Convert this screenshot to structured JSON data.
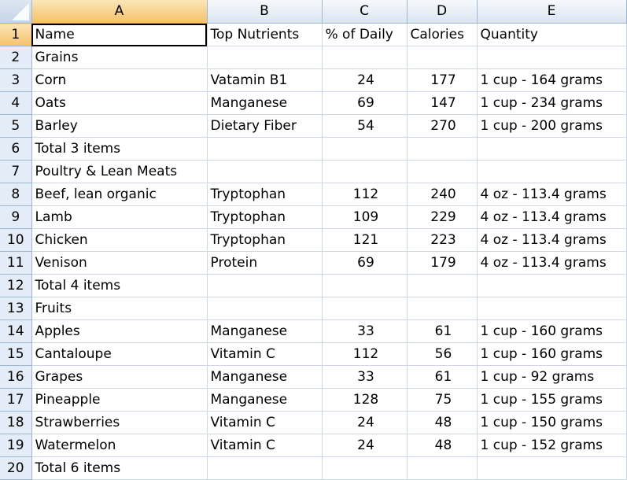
{
  "spreadsheet": {
    "columns": [
      "A",
      "B",
      "C",
      "D",
      "E"
    ],
    "selected_cell": "A1",
    "accent_color": "#f5c26b",
    "rows": [
      {
        "num": "1",
        "cells": [
          "Name",
          "Top Nutrients",
          "% of Daily",
          "Calories",
          "Quantity"
        ]
      },
      {
        "num": "2",
        "cells": [
          "Grains",
          "",
          "",
          "",
          ""
        ]
      },
      {
        "num": "3",
        "cells": [
          "Corn",
          "Vatamin B1",
          "24",
          "177",
          "1 cup - 164 grams"
        ]
      },
      {
        "num": "4",
        "cells": [
          "Oats",
          "Manganese",
          "69",
          "147",
          "1 cup - 234 grams"
        ]
      },
      {
        "num": "5",
        "cells": [
          "Barley",
          "Dietary Fiber",
          "54",
          "270",
          "1 cup - 200 grams"
        ]
      },
      {
        "num": "6",
        "cells": [
          "Total 3 items",
          "",
          "",
          "",
          ""
        ]
      },
      {
        "num": "7",
        "cells": [
          "Poultry & Lean Meats",
          "",
          "",
          "",
          ""
        ]
      },
      {
        "num": "8",
        "cells": [
          "Beef, lean organic",
          "Tryptophan",
          "112",
          "240",
          "4 oz - 113.4 grams"
        ]
      },
      {
        "num": "9",
        "cells": [
          "Lamb",
          "Tryptophan",
          "109",
          "229",
          "4 oz - 113.4 grams"
        ]
      },
      {
        "num": "10",
        "cells": [
          "Chicken",
          "Tryptophan",
          "121",
          "223",
          "4 oz - 113.4 grams"
        ]
      },
      {
        "num": "11",
        "cells": [
          "Venison",
          "Protein",
          "69",
          "179",
          "4 oz - 113.4 grams"
        ]
      },
      {
        "num": "12",
        "cells": [
          "Total 4 items",
          "",
          "",
          "",
          ""
        ]
      },
      {
        "num": "13",
        "cells": [
          "Fruits",
          "",
          "",
          "",
          ""
        ]
      },
      {
        "num": "14",
        "cells": [
          "Apples",
          "Manganese",
          "33",
          "61",
          "1 cup - 160 grams"
        ]
      },
      {
        "num": "15",
        "cells": [
          "Cantaloupe",
          "Vitamin C",
          "112",
          "56",
          "1 cup - 160 grams"
        ]
      },
      {
        "num": "16",
        "cells": [
          "Grapes",
          "Manganese",
          "33",
          "61",
          "1 cup - 92 grams"
        ]
      },
      {
        "num": "17",
        "cells": [
          "Pineapple",
          "Manganese",
          "128",
          "75",
          "1 cup - 155 grams"
        ]
      },
      {
        "num": "18",
        "cells": [
          "Strawberries",
          "Vitamin C",
          "24",
          "48",
          "1 cup - 150 grams"
        ]
      },
      {
        "num": "19",
        "cells": [
          "Watermelon",
          "Vitamin C",
          "24",
          "48",
          "1 cup - 152 grams"
        ]
      },
      {
        "num": "20",
        "cells": [
          "Total 6 items",
          "",
          "",
          "",
          ""
        ]
      }
    ]
  }
}
